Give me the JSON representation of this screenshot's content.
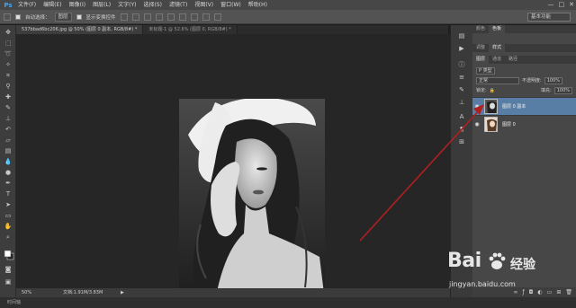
{
  "app": {
    "logo": "Ps"
  },
  "menu": [
    "文件(F)",
    "编辑(E)",
    "图像(I)",
    "图层(L)",
    "文字(Y)",
    "选择(S)",
    "滤镜(T)",
    "视图(V)",
    "窗口(W)",
    "帮助(H)"
  ],
  "window_controls": {
    "minimize": "—",
    "maximize": "□",
    "close": "✕"
  },
  "options": {
    "auto_select_label": "自动选择：",
    "auto_select_value": "图层",
    "show_transform_label": "显示变换控件",
    "workspace": "基本功能"
  },
  "document_tabs": [
    {
      "label": "537bbad6bc206.jpg @ 50% (图层 0 副本, RGB/8#) *",
      "active": true
    },
    {
      "label": "未标题-1 @ 52.6% (图层 0, RGB/8#) *",
      "active": false
    }
  ],
  "status": {
    "zoom": "50%",
    "doc": "文档:1.91M/3.83M",
    "arrow": "▶"
  },
  "bottom_bar": {
    "label": "时间轴"
  },
  "panels": {
    "top_tabs": [
      "颜色",
      "色板"
    ],
    "mid_tabs": [
      "调整",
      "样式"
    ],
    "layer_tabs": [
      "图层",
      "通道",
      "路径"
    ],
    "kind_select": "P 类型",
    "blend_mode": "正常",
    "opacity_label": "不透明度:",
    "opacity_value": "100%",
    "lock_label": "锁定:",
    "fill_label": "填充:",
    "fill_value": "100%",
    "layers": [
      {
        "name": "图层 0 副本",
        "selected": true
      },
      {
        "name": "图层 0",
        "selected": false
      }
    ]
  },
  "watermark": {
    "logo": "Bai",
    "cn": "经验",
    "url": "jingyan.baidu.com"
  },
  "colors": {
    "accent_selected": "#597ea6",
    "arrow": "#b0201e",
    "ps_blue": "#4aa3e6"
  }
}
